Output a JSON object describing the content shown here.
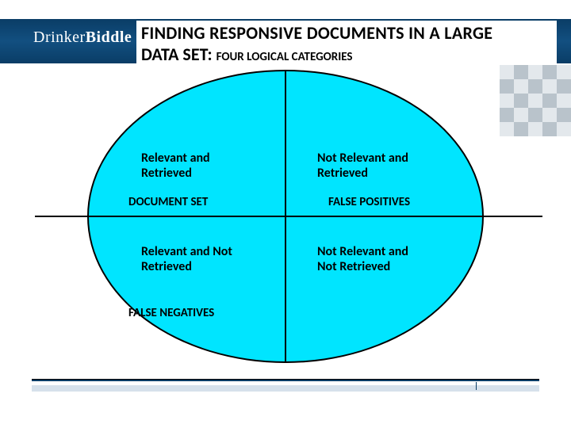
{
  "brand": {
    "part1": "Drinker",
    "part2": "Biddle"
  },
  "title": {
    "line1": "FINDING RESPONSIVE DOCUMENTS IN A LARGE",
    "line2_main": "DATA SET:",
    "line2_sub": "FOUR LOGICAL CATEGORIES"
  },
  "quadrants": {
    "top_left": {
      "label": "Relevant and\nRetrieved",
      "caption": "DOCUMENT SET"
    },
    "top_right": {
      "label": "Not Relevant and\nRetrieved",
      "caption": "FALSE POSITIVES"
    },
    "bot_left": {
      "label": "Relevant and Not\nRetrieved",
      "caption": "FALSE NEGATIVES"
    },
    "bot_right": {
      "label": "Not Relevant and\nNot Retrieved",
      "caption": ""
    }
  },
  "colors": {
    "accent": "#0a3d66",
    "ellipse": "#00e5ff"
  }
}
